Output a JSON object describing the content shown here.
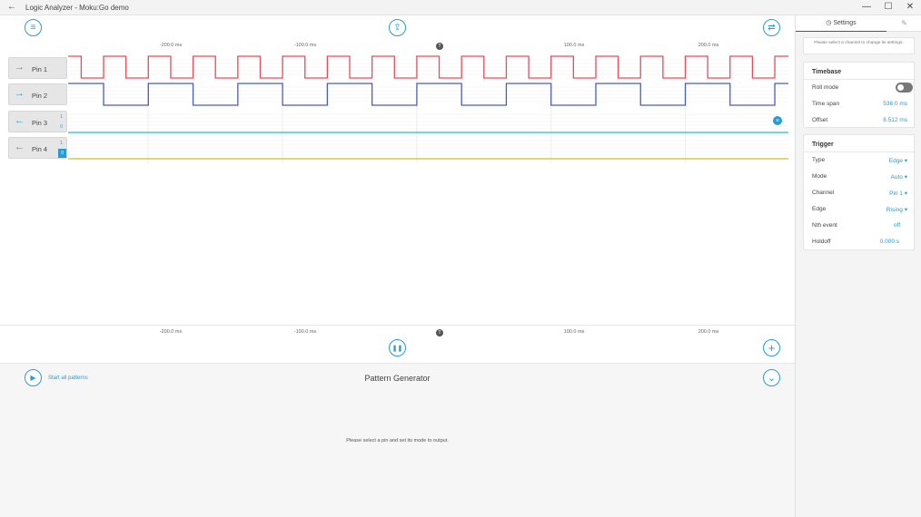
{
  "window": {
    "title": "Logic Analyzer - Moku:Go demo",
    "back_icon": "←",
    "minimize": "—",
    "maximize": "☐",
    "close": "✕"
  },
  "toolbar": {
    "menu_icon": "≡",
    "cloud_icon": "⇪",
    "swap_icon": "⇄"
  },
  "time_axis": {
    "ticks": [
      "-200.0 ms",
      "-100.0 ms",
      "",
      "100.0 ms",
      "200.0 ms"
    ],
    "tick_values_ms": [
      -200,
      -100,
      0,
      100,
      200
    ],
    "trigger_marker": "T",
    "timespan_ms": 536.0,
    "offset_ms": 8.512
  },
  "pins": [
    {
      "label": "Pin 1",
      "direction": "output",
      "arrow": "→",
      "color": "#e74c5c",
      "signal": "square",
      "period_ms": 33.3
    },
    {
      "label": "Pin 2",
      "direction": "output",
      "arrow": "→",
      "color": "#4a5cc7",
      "signal": "square",
      "period_ms": 66.6
    },
    {
      "label": "Pin 3",
      "direction": "input",
      "arrow": "←",
      "color": "#20c0c0",
      "signal": "low",
      "level_high": "1",
      "level_low": "0"
    },
    {
      "label": "Pin 4",
      "direction": "input",
      "arrow": "←",
      "color": "#c8c020",
      "signal": "low",
      "level_high": "1",
      "level_low": "0"
    }
  ],
  "controls": {
    "pause_icon": "❚❚",
    "add_icon": "+",
    "close_cursor_icon": "×"
  },
  "pattern_generator": {
    "start_label": "Start all patterns",
    "title": "Pattern Generator",
    "message": "Please select a pin and set its mode to output.",
    "play_icon": "▶",
    "collapse_icon": "⌄"
  },
  "settings": {
    "tab_label": "Settings",
    "tab_icon": "◷",
    "edit_icon": "✎",
    "hint": "Please select a channel to change its settings.",
    "timebase": {
      "heading": "Timebase",
      "roll_mode_label": "Roll mode",
      "roll_mode_on": false,
      "time_span_label": "Time span",
      "time_span_value": "536.0 ms",
      "offset_label": "Offset",
      "offset_value": "8.512 ms"
    },
    "trigger": {
      "heading": "Trigger",
      "type_label": "Type",
      "type_value": "Edge ▾",
      "mode_label": "Mode",
      "mode_value": "Auto ▾",
      "channel_label": "Channel",
      "channel_value": "Pin 1 ▾",
      "edge_label": "Edge",
      "edge_value": "Rising ▾",
      "nth_label": "Nth event",
      "nth_value": "off",
      "holdoff_label": "Holdoff",
      "holdoff_value": "0.000 s"
    }
  },
  "colors": {
    "accent": "#2a9ad6",
    "grid": "#e4e4e4"
  }
}
